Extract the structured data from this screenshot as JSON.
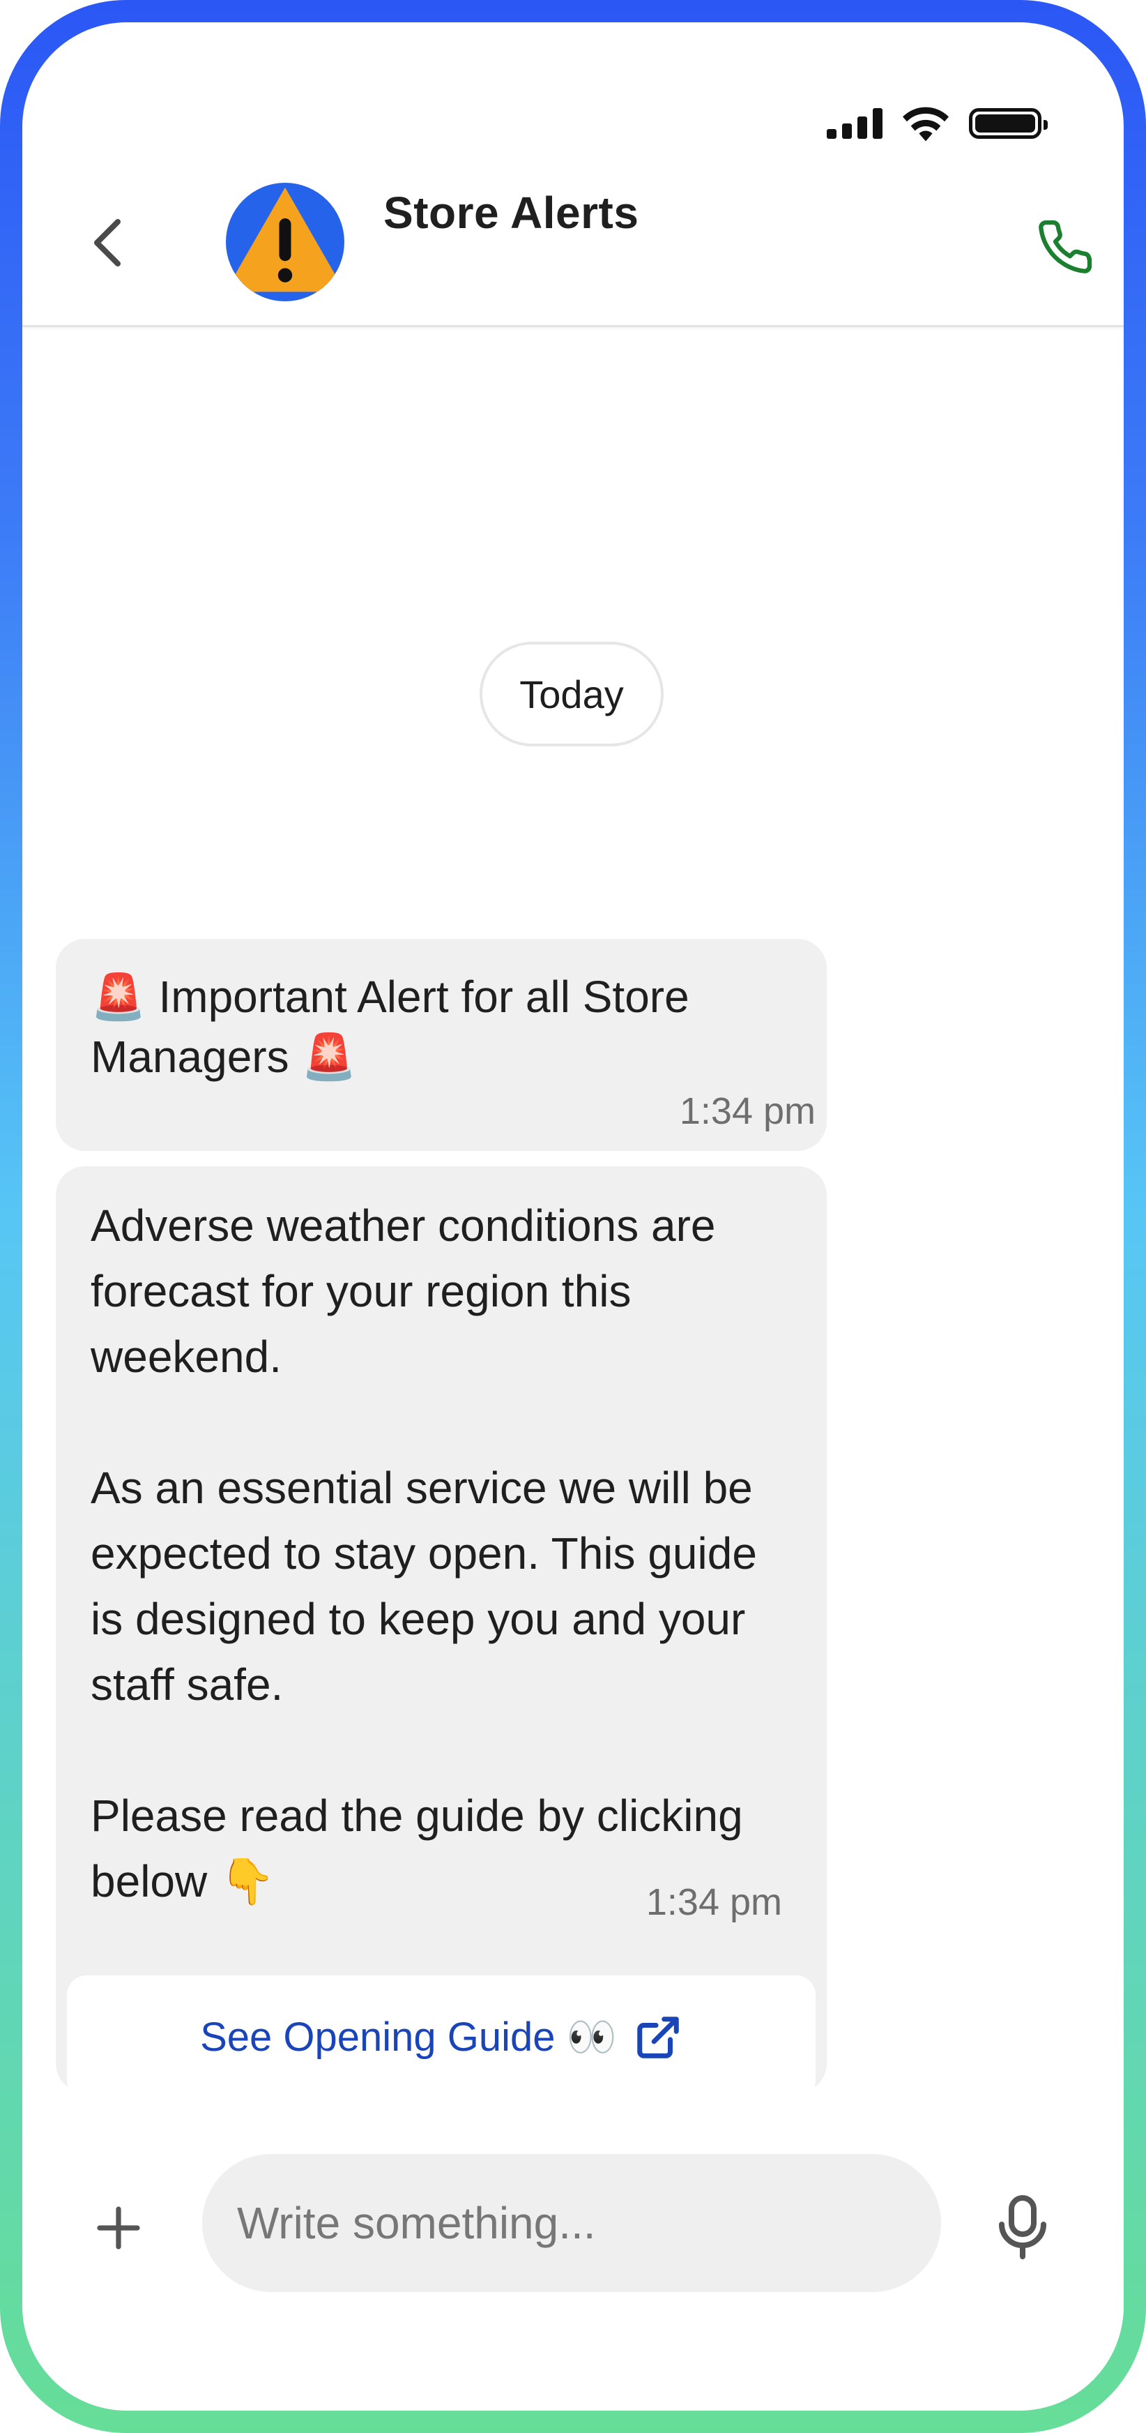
{
  "header": {
    "title": "Store Alerts"
  },
  "date_separator": "Today",
  "messages": [
    {
      "text": "🚨  Important Alert for all Store Managers 🚨",
      "time": "1:34 pm"
    },
    {
      "text": "Adverse weather conditions are forecast for your region this weekend.\n\nAs an essential service we will be expected to stay open. This guide is designed to keep you and your staff safe.\n\nPlease read the guide by clicking below 👇",
      "time": "1:34 pm",
      "button_label": "See Opening Guide 👀"
    }
  ],
  "composer": {
    "placeholder": "Write something..."
  },
  "colors": {
    "frame_top": "#2b57f5",
    "frame_bottom": "#66dd97",
    "call_icon": "#1a7f2e",
    "link": "#1a45b8",
    "bubble": "#f0f0f0"
  },
  "icons": [
    "signal-icon",
    "wifi-icon",
    "battery-icon",
    "back-chevron-icon",
    "warning-icon",
    "phone-call-icon",
    "external-link-icon",
    "plus-icon",
    "microphone-icon"
  ]
}
